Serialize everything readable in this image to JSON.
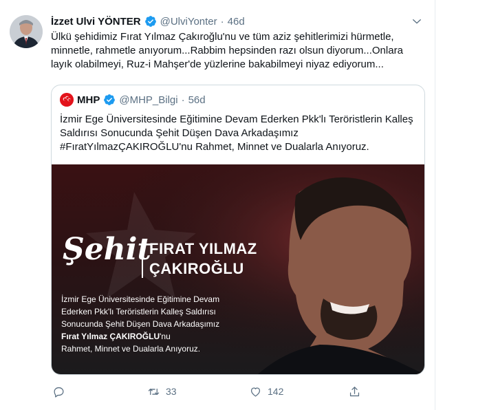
{
  "tweet": {
    "author_name": "İzzet Ulvi YÖNTER",
    "handle": "@UlviYonter",
    "separator": "·",
    "time": "46d",
    "text": "Ülkü şehidimiz Fırat Yılmaz Çakıroğlu'nu ve tüm aziz şehitlerimizi hürmetle, minnetle, rahmetle anıyorum...Rabbim hepsinden razı olsun diyorum...Onlara layık olabilmeyi, Ruz-i Mahşer'de yüzlerine bakabilmeyi niyaz ediyorum..."
  },
  "quote": {
    "author_name": "MHP",
    "handle": "@MHP_Bilgi",
    "separator": "·",
    "time": "56d",
    "text": "İzmir Ege Üniversitesinde Eğitimine Devam Ederken Pkk'lı Teröristlerin Kalleş Saldırısı Sonucunda Şehit Düşen Dava Arkadaşımız #FıratYılmazÇAKIROĞLU'nu Rahmet, Minnet ve Dualarla Anıyoruz."
  },
  "poster": {
    "big_word": "Şehit",
    "name_line1": "FIRAT YILMAZ",
    "name_line2": "ÇAKIROĞLU",
    "body_line1": "İzmir Ege Üniversitesinde Eğitimine Devam",
    "body_line2": "Ederken Pkk'lı Teröristlerin Kalleş Saldırısı",
    "body_line3": "Sonucunda Şehit Düşen Dava Arkadaşımız",
    "body_line4": "Fırat Yılmaz ÇAKIROĞLU",
    "body_line4_suffix": "'nu",
    "body_line5": "Rahmet, Minnet ve Dualarla Anıyoruz."
  },
  "actions": {
    "reply_count": "",
    "retweet_count": "33",
    "like_count": "142"
  },
  "colors": {
    "verified": "#1d9bf0",
    "muted": "#5b7083",
    "mhp_red": "#e3131b"
  },
  "icons": [
    "verified-badge-icon",
    "chevron-down-icon",
    "reply-icon",
    "retweet-icon",
    "like-icon",
    "share-icon",
    "mhp-logo-icon"
  ]
}
